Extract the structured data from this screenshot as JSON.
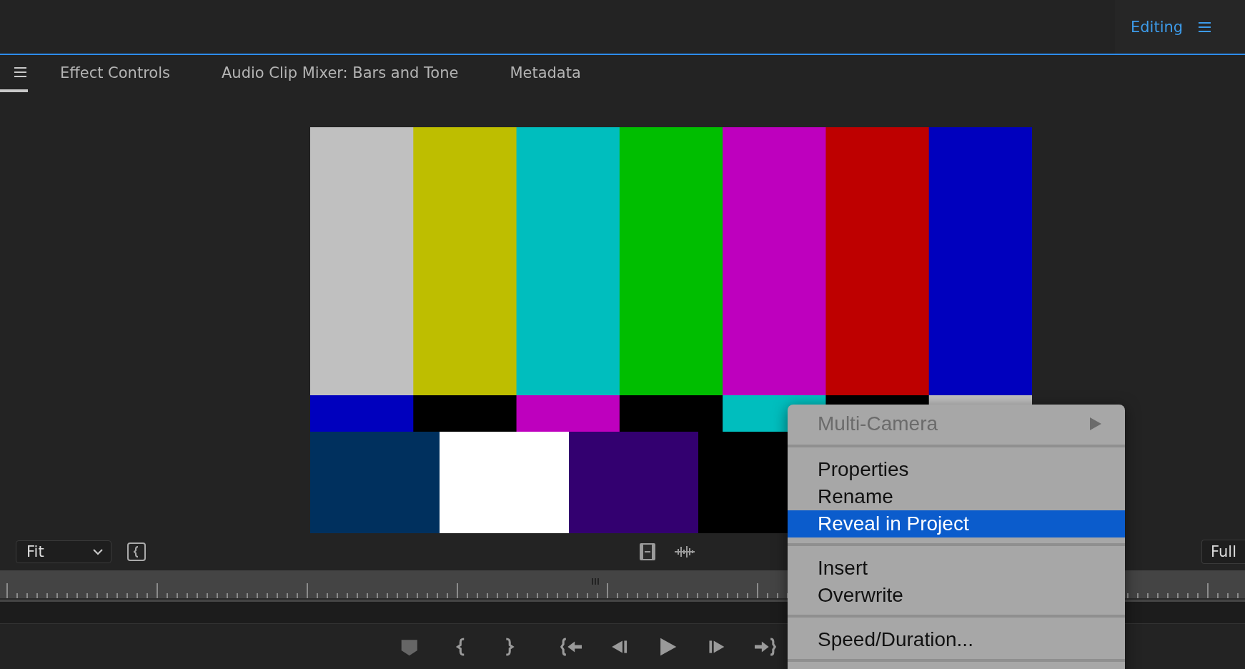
{
  "header": {
    "workspace": "Editing"
  },
  "tabs": [
    {
      "label": "Effect Controls",
      "selected": false
    },
    {
      "label": "Audio Clip Mixer: Bars and Tone",
      "selected": false
    },
    {
      "label": "Metadata",
      "selected": false
    }
  ],
  "viewer": {
    "zoom": "Fit",
    "resolution": "Full"
  },
  "context_menu": {
    "groups": [
      [
        {
          "label": "Multi-Camera",
          "disabled": true,
          "submenu": true,
          "selected": false
        }
      ],
      [
        {
          "label": "Properties",
          "disabled": false,
          "submenu": false,
          "selected": false
        },
        {
          "label": "Rename",
          "disabled": false,
          "submenu": false,
          "selected": false
        },
        {
          "label": "Reveal in Project",
          "disabled": false,
          "submenu": false,
          "selected": true
        }
      ],
      [
        {
          "label": "Insert",
          "disabled": false,
          "submenu": false,
          "selected": false
        },
        {
          "label": "Overwrite",
          "disabled": false,
          "submenu": false,
          "selected": false
        }
      ],
      [
        {
          "label": "Speed/Duration...",
          "disabled": false,
          "submenu": false,
          "selected": false
        }
      ]
    ]
  }
}
